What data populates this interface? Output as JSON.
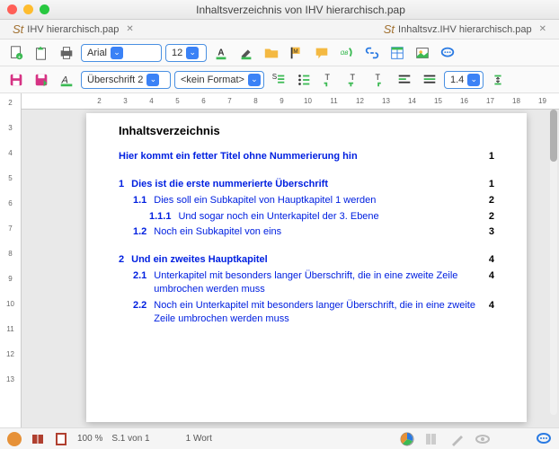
{
  "window": {
    "title": "Inhaltsverzeichnis von IHV hierarchisch.pap"
  },
  "tabs": [
    {
      "label": "IHV hierarchisch.pap"
    },
    {
      "label": "Inhaltsvz.IHV hierarchisch.pap"
    }
  ],
  "toolbar1": {
    "font": "Arial",
    "size": "12"
  },
  "toolbar2": {
    "style": "Überschrift 2",
    "format": "<kein Format>",
    "lineheight": "1.4"
  },
  "ruler_h": [
    "2",
    "3",
    "4",
    "5",
    "6",
    "7",
    "8",
    "9",
    "10",
    "11",
    "12",
    "13",
    "14",
    "15",
    "16",
    "17",
    "18",
    "19"
  ],
  "ruler_v": [
    "2",
    "3",
    "4",
    "5",
    "6",
    "7",
    "8",
    "9",
    "10",
    "11",
    "12",
    "13"
  ],
  "doc": {
    "heading": "Inhaltsverzeichnis",
    "entries": [
      {
        "lvl": 1,
        "num": "",
        "txt": "Hier kommt ein fetter Titel ohne Nummerierung hin",
        "pg": "1",
        "bold": true
      },
      {
        "gap": true
      },
      {
        "lvl": 1,
        "num": "1",
        "txt": "Dies ist die erste nummerierte Überschrift",
        "pg": "1",
        "bold": true
      },
      {
        "lvl": 2,
        "num": "1.1",
        "txt": "Dies soll ein Subkapitel von Hauptkapitel 1 werden",
        "pg": "2"
      },
      {
        "lvl": 3,
        "num": "1.1.1",
        "txt": "Und sogar noch ein Unterkapitel der 3. Ebene",
        "pg": "2"
      },
      {
        "lvl": 2,
        "num": "1.2",
        "txt": "Noch ein Subkapitel von eins",
        "pg": "3"
      },
      {
        "gap": true
      },
      {
        "lvl": 1,
        "num": "2",
        "txt": "Und ein zweites Hauptkapitel",
        "pg": "4",
        "bold": true
      },
      {
        "lvl": 2,
        "num": "2.1",
        "txt": "Unterkapitel mit besonders langer Überschrift, die in eine zweite Zeile umbrochen werden muss",
        "pg": "4"
      },
      {
        "lvl": 2,
        "num": "2.2",
        "txt": "Noch ein Unterkapitel mit besonders langer Überschrift, die in eine zweite Zeile umbrochen werden muss",
        "pg": "4"
      }
    ]
  },
  "status": {
    "zoom": "100 %",
    "page": "S.1 von 1",
    "words": "1 Wort"
  }
}
